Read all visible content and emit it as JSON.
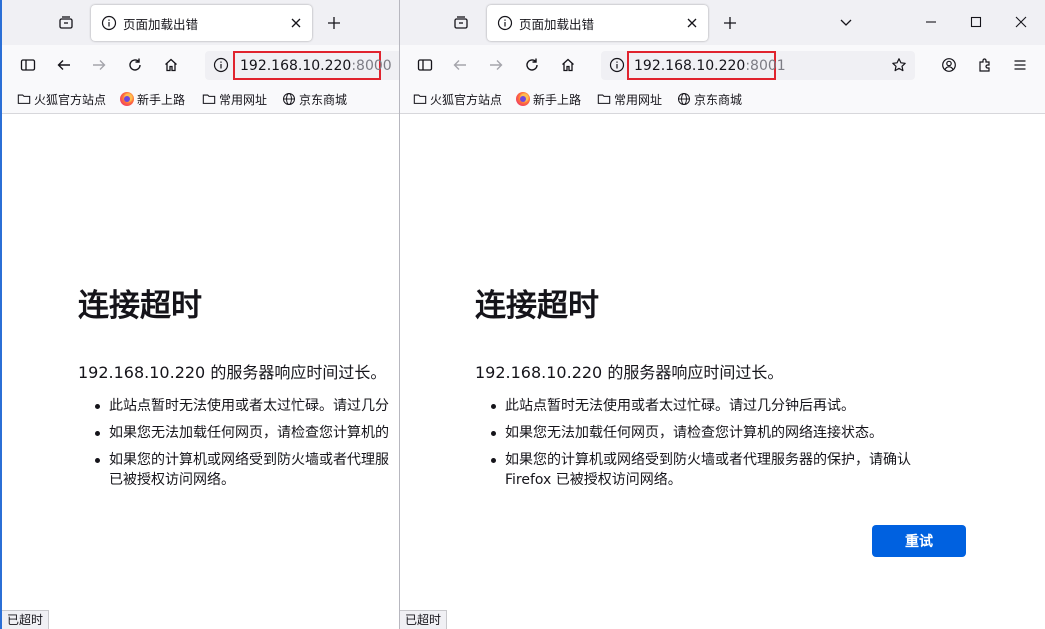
{
  "left": {
    "tab_title": "页面加载出错",
    "url_host": "192.168.10.220",
    "url_port": ":8000",
    "bookmarks": [
      "火狐官方站点",
      "新手上路",
      "常用网址",
      "京东商城"
    ],
    "error_title": "连接超时",
    "error_desc": "192.168.10.220 的服务器响应时间过长。",
    "bullets": [
      "此站点暂时无法使用或者太过忙碌。请过几分",
      "如果您无法加载任何网页，请检查您计算机的",
      "如果您的计算机或网络受到防火墙或者代理服",
      "已被授权访问网络。"
    ],
    "status": "已超时"
  },
  "right": {
    "tab_title": "页面加载出错",
    "url_host": "192.168.10.220",
    "url_port": ":8001",
    "bookmarks": [
      "火狐官方站点",
      "新手上路",
      "常用网址",
      "京东商城"
    ],
    "error_title": "连接超时",
    "error_desc": "192.168.10.220 的服务器响应时间过长。",
    "bullets": [
      "此站点暂时无法使用或者太过忙碌。请过几分钟后再试。",
      "如果您无法加载任何网页，请检查您计算机的网络连接状态。",
      "如果您的计算机或网络受到防火墙或者代理服务器的保护，请确认",
      "Firefox 已被授权访问网络。"
    ],
    "retry_label": "重试",
    "status": "已超时"
  },
  "colors": {
    "accent": "#0061e0",
    "highlight": "#e0232e"
  }
}
